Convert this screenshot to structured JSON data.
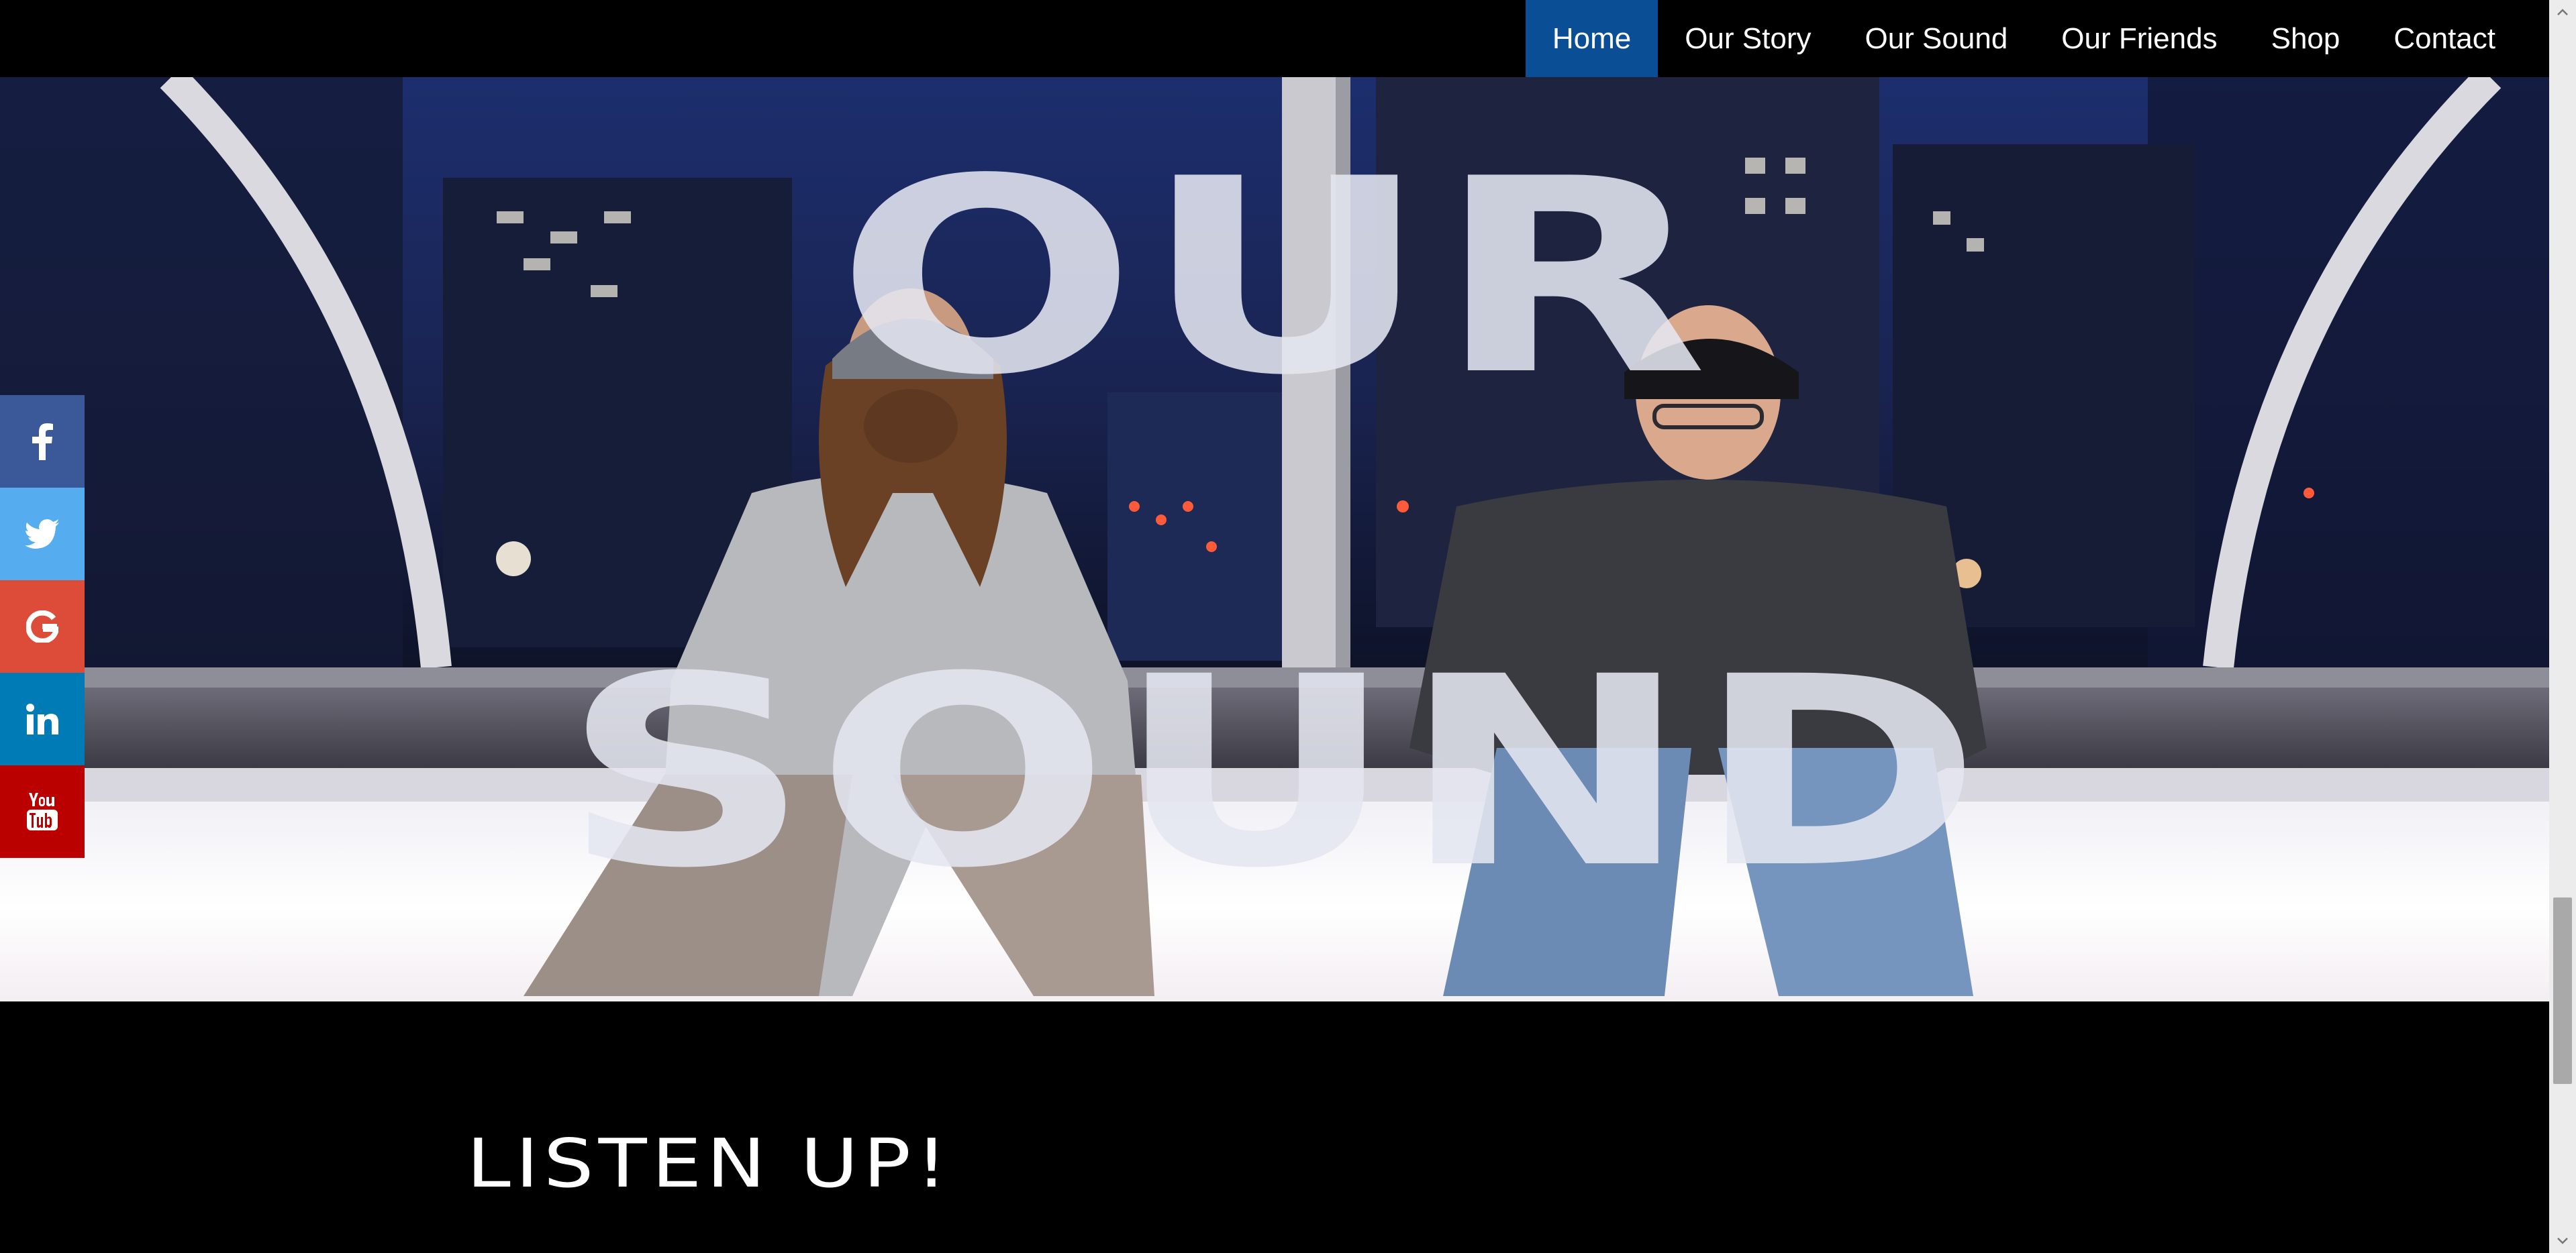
{
  "nav": {
    "items": [
      {
        "label": "Home"
      },
      {
        "label": "Our Story"
      },
      {
        "label": "Our Sound"
      },
      {
        "label": "Our Friends"
      },
      {
        "label": "Shop"
      },
      {
        "label": "Contact"
      }
    ],
    "active_color": "#0a4f95"
  },
  "hero": {
    "title_line1": "OUR",
    "title_line2": "SOUND"
  },
  "social": {
    "items": [
      {
        "icon": "facebook-icon",
        "color": "#3b5998"
      },
      {
        "icon": "twitter-icon",
        "color": "#55acee"
      },
      {
        "icon": "google-icon",
        "color": "#dd4b39"
      },
      {
        "icon": "linkedin-icon",
        "color": "#007bb6"
      },
      {
        "icon": "youtube-icon",
        "color": "#bb0000"
      }
    ]
  },
  "section": {
    "heading": "LISTEN UP!"
  }
}
